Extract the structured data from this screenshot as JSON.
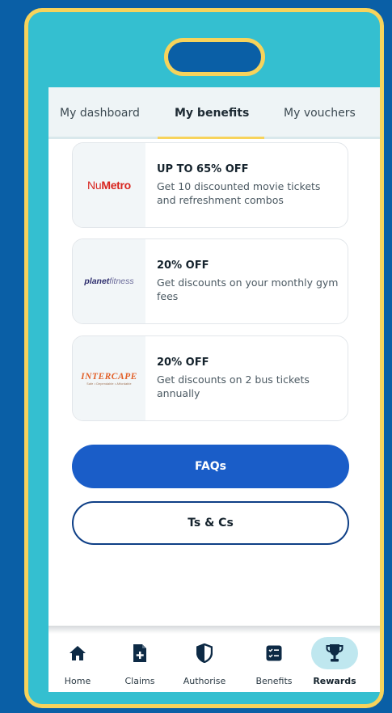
{
  "tabs": [
    {
      "label": "My dashboard"
    },
    {
      "label": "My benefits"
    },
    {
      "label": "My vouchers"
    }
  ],
  "benefits": [
    {
      "logo_text_a": "Nu",
      "logo_text_b": "Metro",
      "title": "UP TO 65% OFF",
      "desc": "Get 10 discounted movie tickets and refreshment combos"
    },
    {
      "logo_text_a": "planet",
      "logo_text_b": "fitness",
      "title": "20% OFF",
      "desc": "Get discounts on your monthly gym fees"
    },
    {
      "logo_text_a": "INTERCAPE",
      "logo_text_b": "Safe • Dependable • Affordable",
      "title": "20% OFF",
      "desc": "Get discounts on 2 bus tickets annually"
    }
  ],
  "buttons": {
    "faqs": "FAQs",
    "terms": "Ts & Cs"
  },
  "nav": [
    {
      "label": "Home",
      "icon": "home-icon"
    },
    {
      "label": "Claims",
      "icon": "claims-document-icon"
    },
    {
      "label": "Authorise",
      "icon": "shield-icon"
    },
    {
      "label": "Benefits",
      "icon": "benefits-icon"
    },
    {
      "label": "Rewards",
      "icon": "trophy-icon"
    }
  ],
  "colors": {
    "background": "#0a5fa6",
    "frame": "#34bfd0",
    "accent": "#f7d35b",
    "primary_button": "#1a5dc8"
  }
}
